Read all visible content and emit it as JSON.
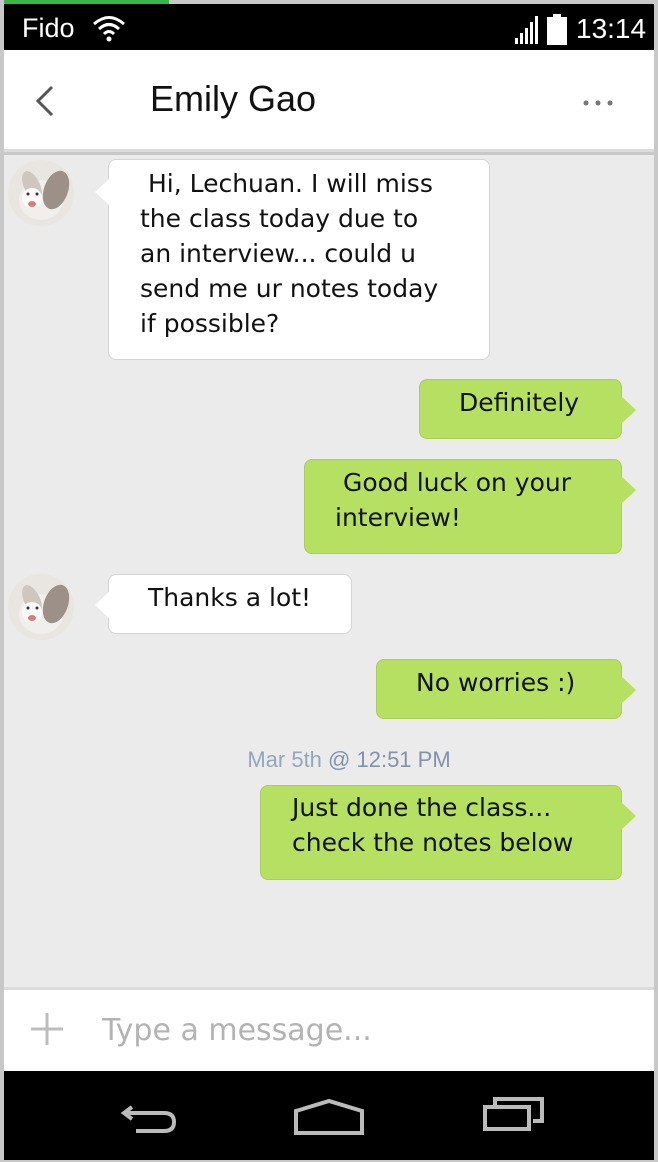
{
  "status_bar": {
    "carrier": "Fido",
    "time": "13:14"
  },
  "header": {
    "title": "Emily Gao"
  },
  "messages": [
    {
      "direction": "incoming",
      "text": " Hi, Lechuan. I will miss\nthe class today due to\nan interview... could u\nsend me ur notes today\nif possible?"
    },
    {
      "direction": "outgoing",
      "text": "Definitely"
    },
    {
      "direction": "outgoing",
      "text": " Good luck on your\ninterview!"
    },
    {
      "direction": "incoming",
      "text": "Thanks a lot!"
    },
    {
      "direction": "outgoing",
      "text": "No worries :)"
    },
    {
      "direction": "outgoing",
      "text": "Just done the class...\ncheck the notes below"
    }
  ],
  "timestamp": {
    "date": "Mar 5th",
    "time": "@ 12:51 PM"
  },
  "composer": {
    "placeholder": "Type a message..."
  },
  "colors": {
    "outgoing_bubble": "#b5e061",
    "incoming_bubble": "#ffffff",
    "chat_background": "#ebebeb",
    "status_accent": "#3ab54a"
  },
  "icons": [
    "wifi-icon",
    "signal-icon",
    "battery-icon",
    "back-icon",
    "more-icon",
    "avatar",
    "plus-icon",
    "nav-back-icon",
    "nav-home-icon",
    "nav-recents-icon"
  ]
}
